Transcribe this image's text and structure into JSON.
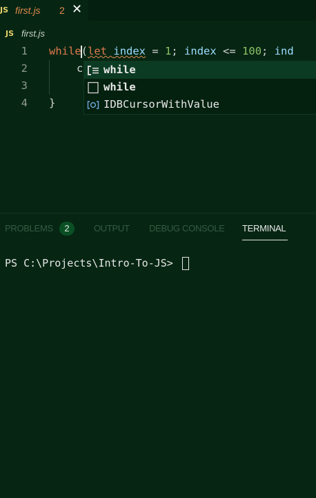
{
  "tab": {
    "lang_badge": "JS",
    "file_name": "first.js",
    "problem_count": "2",
    "close_glyph": "✕"
  },
  "breadcrumb": {
    "lang_badge": "JS",
    "file_name": "first.js"
  },
  "editor": {
    "line_numbers": [
      "1",
      "2",
      "3",
      "4"
    ],
    "line1": {
      "kw_while": "while",
      "paren_open": "(",
      "kw_let": "let",
      "var_index": "index",
      "eq": " = ",
      "num_1": "1",
      "semi1": "; ",
      "var_index2": "index",
      "lte": " <= ",
      "num_100": "100",
      "semi2": "; ",
      "var_ind": "ind"
    },
    "line2_partial": "c",
    "line4": "}"
  },
  "suggest": {
    "items": [
      {
        "label": "while",
        "icon": "snippet-icon",
        "selected": true
      },
      {
        "label": "while",
        "icon": "keyword-icon",
        "selected": false
      },
      {
        "label": "IDBCursorWithValue",
        "icon": "variable-icon",
        "selected": false
      }
    ]
  },
  "panel": {
    "tabs": [
      "PROBLEMS",
      "OUTPUT",
      "DEBUG CONSOLE",
      "TERMINAL"
    ],
    "problems_badge": "2",
    "active_tab": "TERMINAL",
    "terminal_prompt": "PS C:\\Projects\\Intro-To-JS> "
  },
  "colors": {
    "background": "#062613",
    "keyword": "#e07a4f",
    "variable": "#9cdcfe",
    "number": "#8cc265",
    "tab_title": "#e0894e",
    "js_badge": "#e5d06a"
  }
}
